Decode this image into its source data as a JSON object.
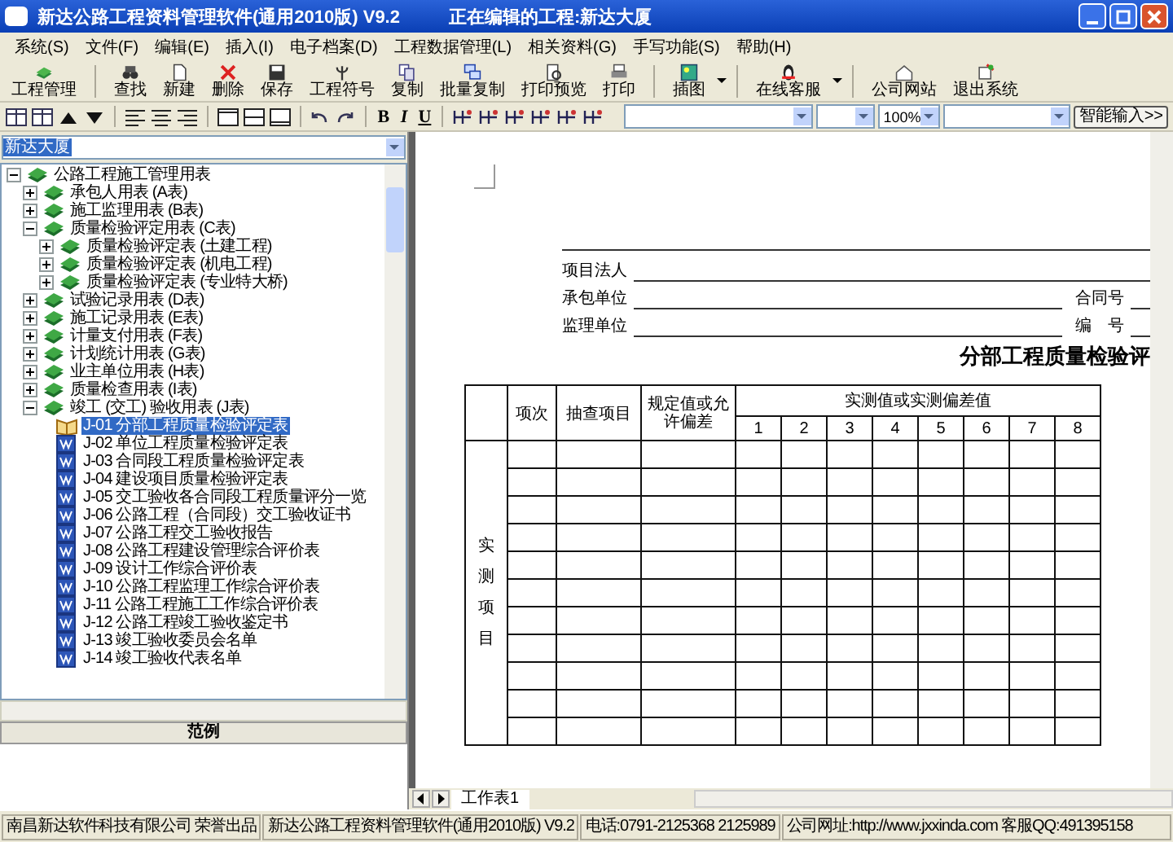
{
  "window": {
    "title": "新达公路工程资料管理软件(通用2010版) V9.2",
    "subtitle": "正在编辑的工程:新达大厦"
  },
  "menu": [
    "系统(S)",
    "文件(F)",
    "编辑(E)",
    "插入(I)",
    "电子档案(D)",
    "工程数据管理(L)",
    "相关资料(G)",
    "手写功能(S)",
    "帮助(H)"
  ],
  "toolbar": {
    "groups": [
      [
        {
          "label": "工程管理",
          "dropdown": false
        }
      ],
      [
        {
          "label": "查找",
          "dropdown": false
        },
        {
          "label": "新建",
          "dropdown": false
        },
        {
          "label": "删除",
          "dropdown": false
        },
        {
          "label": "保存",
          "dropdown": false
        },
        {
          "label": "工程符号",
          "dropdown": false
        },
        {
          "label": "复制",
          "dropdown": false
        },
        {
          "label": "批量复制",
          "dropdown": false
        },
        {
          "label": "打印预览",
          "dropdown": false
        },
        {
          "label": "打印",
          "dropdown": false
        }
      ],
      [
        {
          "label": "插图",
          "dropdown": true
        }
      ],
      [
        {
          "label": "在线客服",
          "dropdown": true
        }
      ],
      [
        {
          "label": "公司网站",
          "dropdown": false
        },
        {
          "label": "退出系统",
          "dropdown": false
        }
      ]
    ]
  },
  "format_bar": {
    "text_buttons": [
      "B",
      "I",
      "U"
    ],
    "zoom_combo": "100%",
    "smart_input": "智能输入>>"
  },
  "project_combo": {
    "value": "新达大厦"
  },
  "tree": [
    {
      "label": "公路工程施工管理用表",
      "kind": "group",
      "expanded": true,
      "selected": false,
      "children": [
        {
          "label": "承包人用表 (A表)",
          "kind": "group",
          "expanded": false,
          "selected": false
        },
        {
          "label": "施工监理用表 (B表)",
          "kind": "group",
          "expanded": false,
          "selected": false
        },
        {
          "label": "质量检验评定用表 (C表)",
          "kind": "group",
          "expanded": true,
          "selected": false,
          "children": [
            {
              "label": "质量检验评定表 (土建工程)",
              "kind": "group",
              "expanded": false,
              "selected": false
            },
            {
              "label": "质量检验评定表 (机电工程)",
              "kind": "group",
              "expanded": false,
              "selected": false
            },
            {
              "label": "质量检验评定表 (专业特大桥)",
              "kind": "group",
              "expanded": false,
              "selected": false
            }
          ]
        },
        {
          "label": "试验记录用表 (D表)",
          "kind": "group",
          "expanded": false,
          "selected": false
        },
        {
          "label": "施工记录用表 (E表)",
          "kind": "group",
          "expanded": false,
          "selected": false
        },
        {
          "label": "计量支付用表 (F表)",
          "kind": "group",
          "expanded": false,
          "selected": false
        },
        {
          "label": "计划统计用表 (G表)",
          "kind": "group",
          "expanded": false,
          "selected": false
        },
        {
          "label": "业主单位用表 (H表)",
          "kind": "group",
          "expanded": false,
          "selected": false
        },
        {
          "label": "质量检查用表 (I表)",
          "kind": "group",
          "expanded": false,
          "selected": false
        },
        {
          "label": "竣工 (交工) 验收用表 (J表)",
          "kind": "group",
          "expanded": true,
          "selected": false,
          "children": [
            {
              "label": "J-01 分部工程质量检验评定表",
              "kind": "form",
              "selected": true
            },
            {
              "label": "J-02 单位工程质量检验评定表",
              "kind": "form",
              "selected": false
            },
            {
              "label": "J-03 合同段工程质量检验评定表",
              "kind": "form",
              "selected": false
            },
            {
              "label": "J-04 建设项目质量检验评定表",
              "kind": "form",
              "selected": false
            },
            {
              "label": "J-05 交工验收各合同段工程质量评分一览",
              "kind": "form",
              "selected": false
            },
            {
              "label": "J-06 公路工程（合同段）交工验收证书",
              "kind": "form",
              "selected": false
            },
            {
              "label": "J-07 公路工程交工验收报告",
              "kind": "form",
              "selected": false
            },
            {
              "label": "J-08 公路工程建设管理综合评价表",
              "kind": "form",
              "selected": false
            },
            {
              "label": "J-09 设计工作综合评价表",
              "kind": "form",
              "selected": false
            },
            {
              "label": "J-10 公路工程监理工作综合评价表",
              "kind": "form",
              "selected": false
            },
            {
              "label": "J-11 公路工程施工工作综合评价表",
              "kind": "form",
              "selected": false
            },
            {
              "label": "J-12 公路工程竣工验收鉴定书",
              "kind": "form",
              "selected": false
            },
            {
              "label": "J-13 竣工验收委员会名单",
              "kind": "form",
              "selected": false
            },
            {
              "label": "J-14 竣工验收代表名单",
              "kind": "form",
              "selected": false
            }
          ]
        }
      ]
    }
  ],
  "example_header": "范例",
  "document": {
    "fields": [
      {
        "label": "项目法人"
      },
      {
        "label": "承包单位",
        "extra": "合同号"
      },
      {
        "label": "监理单位",
        "extra": "编　号"
      }
    ],
    "title": "分部工程质量检验评",
    "table": {
      "headers": [
        "项次",
        "抽查项目",
        "规定值或允许偏差"
      ],
      "measured_header": "实测值或实测偏差值",
      "measure_columns": [
        "1",
        "2",
        "3",
        "4",
        "5",
        "6",
        "7",
        "8"
      ],
      "side_label": "实测项目"
    }
  },
  "sheet_tab": "工作表1",
  "status_bar": [
    "南昌新达软件科技有限公司 荣誉出品",
    "新达公路工程资料管理软件(通用2010版) V9.2",
    "电话:0791-2125368 2125989",
    "公司网址:http://www.jxxinda.com  客服QQ:491395158"
  ]
}
